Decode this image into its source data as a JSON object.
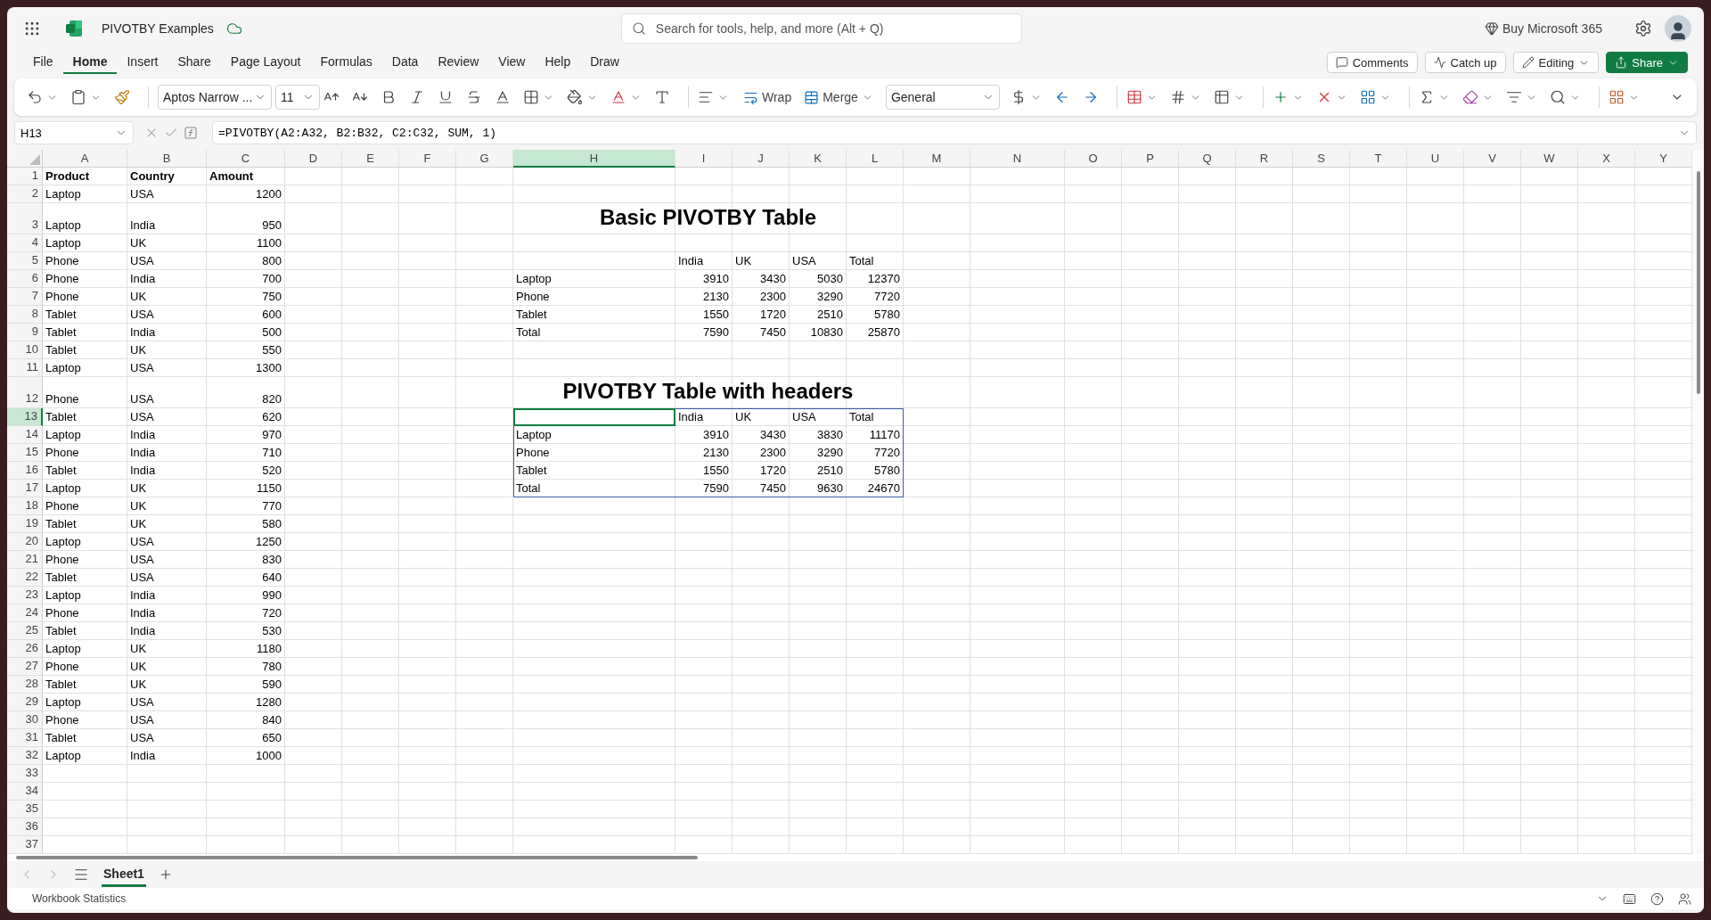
{
  "app": {
    "title": "PIVOTBY Examples",
    "search": {
      "placeholder": "Search for tools, help, and more (Alt + Q)"
    },
    "buy_label": "Buy Microsoft 365"
  },
  "menu_tabs": [
    {
      "label": "File",
      "selected": false
    },
    {
      "label": "Home",
      "selected": true
    },
    {
      "label": "Insert",
      "selected": false
    },
    {
      "label": "Share",
      "selected": false
    },
    {
      "label": "Page Layout",
      "selected": false
    },
    {
      "label": "Formulas",
      "selected": false
    },
    {
      "label": "Data",
      "selected": false
    },
    {
      "label": "Review",
      "selected": false
    },
    {
      "label": "View",
      "selected": false
    },
    {
      "label": "Help",
      "selected": false
    },
    {
      "label": "Draw",
      "selected": false
    }
  ],
  "actions": [
    {
      "label": "Comments",
      "kind": "comments"
    },
    {
      "label": "Catch up",
      "kind": "catchup"
    },
    {
      "label": "Editing",
      "kind": "editing"
    },
    {
      "label": "Share",
      "kind": "share"
    }
  ],
  "ribbon": {
    "font": "Aptos Narrow ...",
    "size": "11",
    "wrap": "Wrap",
    "merge": "Merge",
    "number_format": "General"
  },
  "formula_bar": {
    "name_box": "H13",
    "formula": "=PIVOTBY(A2:A32, B2:B32, C2:C32, SUM, 1)"
  },
  "sheet": {
    "columns": [
      {
        "label": "A",
        "selected": false
      },
      {
        "label": "B",
        "selected": false
      },
      {
        "label": "C",
        "selected": false
      },
      {
        "label": "D",
        "selected": false
      },
      {
        "label": "E",
        "selected": false
      },
      {
        "label": "F",
        "selected": false
      },
      {
        "label": "G",
        "selected": false
      },
      {
        "label": "H",
        "selected": true
      },
      {
        "label": "I",
        "selected": false
      },
      {
        "label": "J",
        "selected": false
      },
      {
        "label": "K",
        "selected": false
      },
      {
        "label": "L",
        "selected": false
      },
      {
        "label": "M",
        "selected": false
      },
      {
        "label": "N",
        "selected": false
      },
      {
        "label": "O",
        "selected": false
      },
      {
        "label": "P",
        "selected": false
      },
      {
        "label": "Q",
        "selected": false
      },
      {
        "label": "R",
        "selected": false
      },
      {
        "label": "S",
        "selected": false
      },
      {
        "label": "T",
        "selected": false
      },
      {
        "label": "U",
        "selected": false
      },
      {
        "label": "V",
        "selected": false
      },
      {
        "label": "W",
        "selected": false
      },
      {
        "label": "X",
        "selected": false
      },
      {
        "label": "Y",
        "selected": false
      }
    ],
    "rows": [
      {
        "label": "1",
        "selected": false
      },
      {
        "label": "2",
        "selected": false
      },
      {
        "label": "3",
        "selected": false
      },
      {
        "label": "4",
        "selected": false
      },
      {
        "label": "5",
        "selected": false
      },
      {
        "label": "6",
        "selected": false
      },
      {
        "label": "7",
        "selected": false
      },
      {
        "label": "8",
        "selected": false
      },
      {
        "label": "9",
        "selected": false
      },
      {
        "label": "10",
        "selected": false
      },
      {
        "label": "11",
        "selected": false
      },
      {
        "label": "12",
        "selected": false
      },
      {
        "label": "13",
        "selected": true
      },
      {
        "label": "14",
        "selected": false
      },
      {
        "label": "15",
        "selected": false
      },
      {
        "label": "16",
        "selected": false
      },
      {
        "label": "17",
        "selected": false
      },
      {
        "label": "18",
        "selected": false
      },
      {
        "label": "19",
        "selected": false
      },
      {
        "label": "20",
        "selected": false
      },
      {
        "label": "21",
        "selected": false
      },
      {
        "label": "22",
        "selected": false
      },
      {
        "label": "23",
        "selected": false
      },
      {
        "label": "24",
        "selected": false
      },
      {
        "label": "25",
        "selected": false
      },
      {
        "label": "26",
        "selected": false
      },
      {
        "label": "27",
        "selected": false
      },
      {
        "label": "28",
        "selected": false
      },
      {
        "label": "29",
        "selected": false
      },
      {
        "label": "30",
        "selected": false
      },
      {
        "label": "31",
        "selected": false
      },
      {
        "label": "32",
        "selected": false
      },
      {
        "label": "33",
        "selected": false
      },
      {
        "label": "34",
        "selected": false
      },
      {
        "label": "35",
        "selected": false
      },
      {
        "label": "36",
        "selected": false
      },
      {
        "label": "37",
        "selected": false
      }
    ],
    "source_table": {
      "headers": [
        "Product",
        "Country",
        "Amount"
      ],
      "rows": [
        [
          "Laptop",
          "USA",
          "1200"
        ],
        [
          "Laptop",
          "India",
          "950"
        ],
        [
          "Laptop",
          "UK",
          "1100"
        ],
        [
          "Phone",
          "USA",
          "800"
        ],
        [
          "Phone",
          "India",
          "700"
        ],
        [
          "Phone",
          "UK",
          "750"
        ],
        [
          "Tablet",
          "USA",
          "600"
        ],
        [
          "Tablet",
          "India",
          "500"
        ],
        [
          "Tablet",
          "UK",
          "550"
        ],
        [
          "Laptop",
          "USA",
          "1300"
        ],
        [
          "Phone",
          "USA",
          "820"
        ],
        [
          "Tablet",
          "USA",
          "620"
        ],
        [
          "Laptop",
          "India",
          "970"
        ],
        [
          "Phone",
          "India",
          "710"
        ],
        [
          "Tablet",
          "India",
          "520"
        ],
        [
          "Laptop",
          "UK",
          "1150"
        ],
        [
          "Phone",
          "UK",
          "770"
        ],
        [
          "Tablet",
          "UK",
          "580"
        ],
        [
          "Laptop",
          "USA",
          "1250"
        ],
        [
          "Phone",
          "USA",
          "830"
        ],
        [
          "Tablet",
          "USA",
          "640"
        ],
        [
          "Laptop",
          "India",
          "990"
        ],
        [
          "Phone",
          "India",
          "720"
        ],
        [
          "Tablet",
          "India",
          "530"
        ],
        [
          "Laptop",
          "UK",
          "1180"
        ],
        [
          "Phone",
          "UK",
          "780"
        ],
        [
          "Tablet",
          "UK",
          "590"
        ],
        [
          "Laptop",
          "USA",
          "1280"
        ],
        [
          "Phone",
          "USA",
          "840"
        ],
        [
          "Tablet",
          "USA",
          "650"
        ],
        [
          "Laptop",
          "India",
          "1000"
        ]
      ]
    },
    "pivot_tables": [
      {
        "title": "Basic PIVOTBY Table",
        "header": [
          "India",
          "UK",
          "USA",
          "Total"
        ],
        "outlined": false,
        "corner_selected": false,
        "rows": [
          {
            "label": "Laptop",
            "values": [
              "3910",
              "3430",
              "5030",
              "12370"
            ]
          },
          {
            "label": "Phone",
            "values": [
              "2130",
              "2300",
              "3290",
              "7720"
            ]
          },
          {
            "label": "Tablet",
            "values": [
              "1550",
              "1720",
              "2510",
              "5780"
            ]
          },
          {
            "label": "Total",
            "values": [
              "7590",
              "7450",
              "10830",
              "25870"
            ]
          }
        ]
      },
      {
        "title": "PIVOTBY Table with headers",
        "header": [
          "India",
          "UK",
          "USA",
          "Total"
        ],
        "outlined": true,
        "corner_selected": true,
        "rows": [
          {
            "label": "Laptop",
            "values": [
              "3910",
              "3430",
              "3830",
              "11170"
            ]
          },
          {
            "label": "Phone",
            "values": [
              "2130",
              "2300",
              "3290",
              "7720"
            ]
          },
          {
            "label": "Tablet",
            "values": [
              "1550",
              "1720",
              "2510",
              "5780"
            ]
          },
          {
            "label": "Total",
            "values": [
              "7590",
              "7450",
              "9630",
              "24670"
            ]
          }
        ]
      }
    ]
  },
  "sheet_tabs": [
    {
      "label": "Sheet1",
      "selected": true
    }
  ],
  "status_bar": {
    "label": "Workbook Statistics"
  }
}
